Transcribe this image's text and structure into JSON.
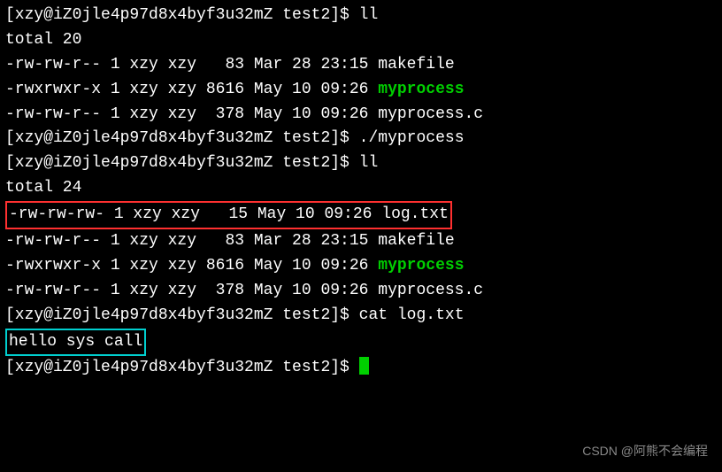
{
  "prompt1": "[xzy@iZ0jle4p97d8x4byf3u32mZ test2]$ ",
  "cmd_ll1": "ll",
  "total1": "total 20",
  "ls1_row1": "-rw-rw-r-- 1 xzy xzy   83 Mar 28 23:15 makefile",
  "ls1_row2_pre": "-rwxrwxr-x 1 xzy xzy 8616 May 10 09:26 ",
  "ls1_row2_name": "myprocess",
  "ls1_row3": "-rw-rw-r-- 1 xzy xzy  378 May 10 09:26 myprocess.c",
  "prompt2": "[xzy@iZ0jle4p97d8x4byf3u32mZ test2]$ ",
  "cmd_run": "./myprocess",
  "prompt3": "[xzy@iZ0jle4p97d8x4byf3u32mZ test2]$ ",
  "cmd_ll2": "ll",
  "total2": "total 24",
  "ls2_row1": "-rw-rw-rw- 1 xzy xzy   15 May 10 09:26 log.txt",
  "ls2_row2": "-rw-rw-r-- 1 xzy xzy   83 Mar 28 23:15 makefile",
  "ls2_row3_pre": "-rwxrwxr-x 1 xzy xzy 8616 May 10 09:26 ",
  "ls2_row3_name": "myprocess",
  "ls2_row4": "-rw-rw-r-- 1 xzy xzy  378 May 10 09:26 myprocess.c",
  "prompt4": "[xzy@iZ0jle4p97d8x4byf3u32mZ test2]$ ",
  "cmd_cat": "cat log.txt",
  "cat_output": "hello sys call",
  "prompt5": "[xzy@iZ0jle4p97d8x4byf3u32mZ test2]$ ",
  "watermark": "CSDN @阿熊不会编程"
}
